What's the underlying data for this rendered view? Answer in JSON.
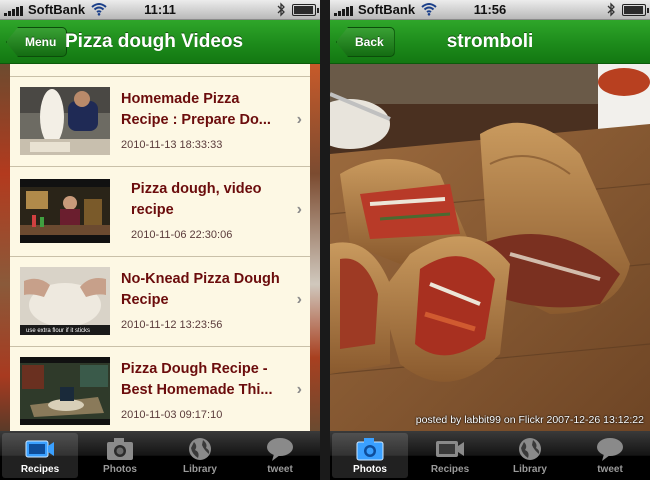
{
  "left_screen": {
    "status": {
      "carrier": "SoftBank",
      "time": "11:11"
    },
    "nav": {
      "back_label": "Menu",
      "title": "Pizza dough Videos"
    },
    "videos": [
      {
        "title": "Homemade Pizza Recipe : Prepare Do...",
        "date": "2010-11-13 18:33:33"
      },
      {
        "title": "Pizza dough, video recipe",
        "date": "2010-11-06 22:30:06"
      },
      {
        "title": "No-Knead Pizza Dough Recipe",
        "date": "2010-11-12 13:23:56",
        "thumb_caption": "use extra flour if it sticks"
      },
      {
        "title": "Pizza Dough Recipe - Best Homemade Thi...",
        "date": "2010-11-03 09:17:10"
      }
    ],
    "tabs": [
      {
        "label": "Recipes",
        "icon": "video-camera-icon",
        "active": true
      },
      {
        "label": "Photos",
        "icon": "camera-icon",
        "active": false
      },
      {
        "label": "Library",
        "icon": "globe-icon",
        "active": false
      },
      {
        "label": "tweet",
        "icon": "speech-bubble-icon",
        "active": false
      }
    ]
  },
  "right_screen": {
    "status": {
      "carrier": "SoftBank",
      "time": "11:56"
    },
    "nav": {
      "back_label": "Back",
      "title": "stromboli"
    },
    "photo_caption": "posted by labbit99 on Flickr 2007-12-26 13:12:22",
    "tabs": [
      {
        "label": "Photos",
        "icon": "camera-icon",
        "active": true
      },
      {
        "label": "Recipes",
        "icon": "video-camera-icon",
        "active": false
      },
      {
        "label": "Library",
        "icon": "globe-icon",
        "active": false
      },
      {
        "label": "tweet",
        "icon": "speech-bubble-icon",
        "active": false
      }
    ]
  },
  "colors": {
    "nav_green": "#1d8b1b",
    "title_maroon": "#6b0c0c",
    "list_background": "#fdf8e4",
    "tab_active_icon": "#3aa0ff"
  }
}
